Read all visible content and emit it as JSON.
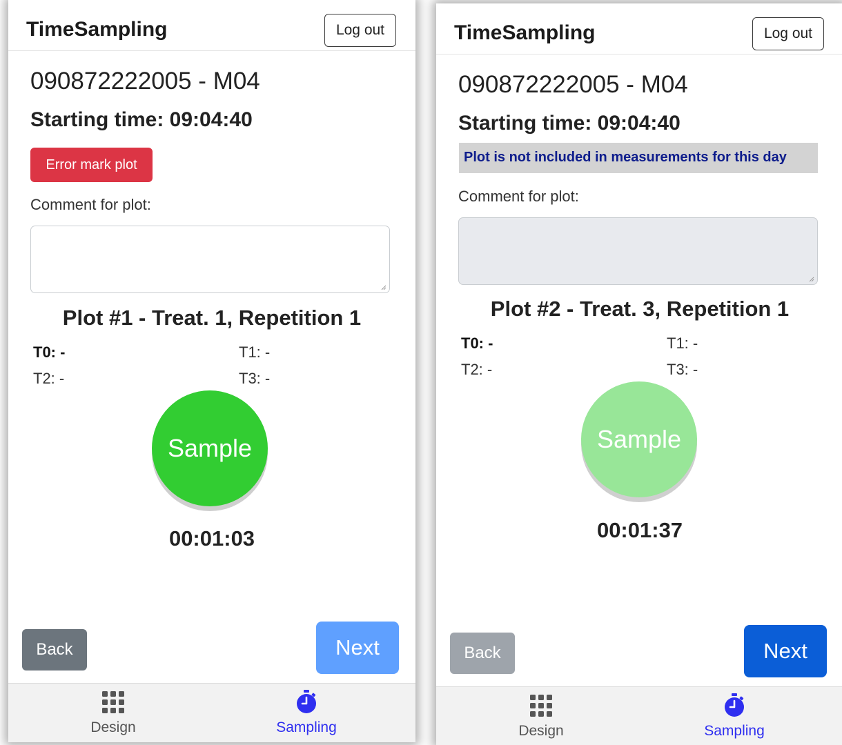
{
  "left": {
    "header": {
      "brand": "TimeSampling",
      "logout_label": "Log out"
    },
    "plot_code": "090872222005 - M04",
    "starting_time": "Starting time: 09:04:40",
    "error_button_label": "Error mark plot",
    "comment_label": "Comment for plot:",
    "comment_value": "",
    "plot_title": "Plot #1 - Treat. 1, Repetition 1",
    "times": {
      "t0": "T0: -",
      "t1": "T1: -",
      "t2": "T2: -",
      "t3": "T3: -"
    },
    "sample_label": "Sample",
    "timer": "00:01:03",
    "back_label": "Back",
    "next_label": "Next",
    "nav": [
      {
        "label": "Design",
        "icon": "grid-icon"
      },
      {
        "label": "Sampling",
        "icon": "stopwatch-icon"
      }
    ]
  },
  "right": {
    "header": {
      "brand": "TimeSampling",
      "logout_label": "Log out"
    },
    "plot_code": "090872222005 - M04",
    "starting_time": "Starting time: 09:04:40",
    "alert_text": "Plot is not included in measurements for this day",
    "comment_label": "Comment for plot:",
    "comment_value": "",
    "plot_title": "Plot #2 - Treat. 3, Repetition 1",
    "times": {
      "t0": "T0: -",
      "t1": "T1: -",
      "t2": "T2: -",
      "t3": "T3: -"
    },
    "sample_label": "Sample",
    "timer": "00:01:37",
    "back_label": "Back",
    "next_label": "Next",
    "nav": [
      {
        "label": "Design",
        "icon": "grid-icon"
      },
      {
        "label": "Sampling",
        "icon": "stopwatch-icon"
      }
    ]
  },
  "colors": {
    "error": "#dc3545",
    "sample_active": "#32cd32",
    "sample_disabled": "#98e698",
    "next_disabled": "#5fa0ff",
    "next_active": "#0b5ed7",
    "back_active": "#6c757d",
    "back_disabled": "#9ea4ab",
    "nav_active": "#2f2ff0",
    "nav_inactive": "#555555",
    "alert_text": "#0e1d8c"
  }
}
